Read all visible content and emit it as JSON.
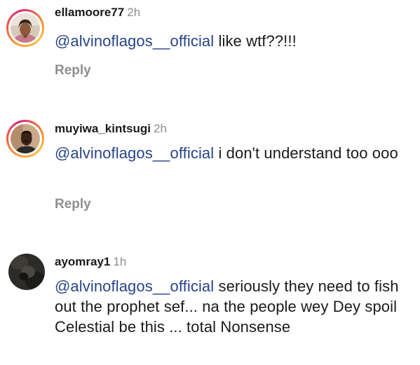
{
  "comments": [
    {
      "username": "ellamoore77",
      "time": "2h",
      "mention": "@alvinoflagos__official",
      "text": " like wtf??!!!",
      "reply_label": "Reply",
      "avatar": "profile-photo-woman",
      "story_ring": true
    },
    {
      "username": "muyiwa_kintsugi",
      "time": "2h",
      "mention": "@alvinoflagos__official",
      "text": " i don't understand too ooo",
      "reply_label": "Reply",
      "avatar": "profile-photo-man",
      "story_ring": true
    },
    {
      "username": "ayomray1",
      "time": "1h",
      "mention": "@alvinoflagos__official",
      "text": " seriously they need to fish out the prophet sef... na the people wey Dey spoil Celestial be this ... total Nonsense",
      "avatar": "profile-photo-dark",
      "story_ring": false
    }
  ],
  "colors": {
    "mention": "#28448a",
    "muted": "#8e8e8e",
    "text": "#1a1a1a"
  }
}
